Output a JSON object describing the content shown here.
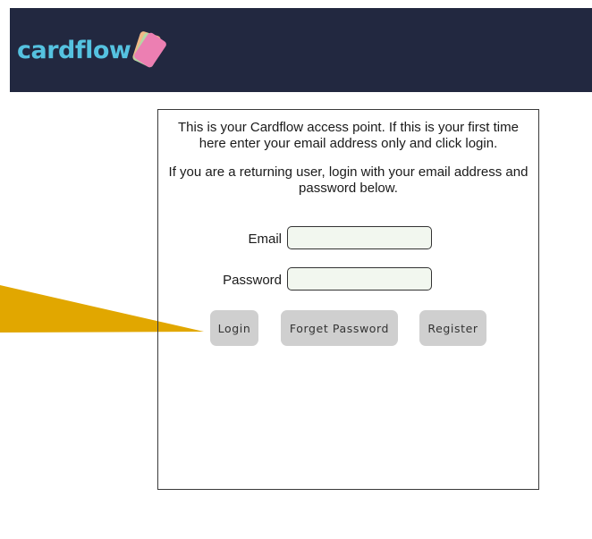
{
  "header": {
    "logo_text": "cardflow",
    "background_color": "#222840",
    "logo_color": "#55c2e0"
  },
  "panel": {
    "intro_text": "This is your Cardflow access point. If this is your first time here enter your email address only and click login.",
    "returning_text": "If you are a returning user, login with your email address and password below."
  },
  "form": {
    "email_label": "Email",
    "email_value": "",
    "password_label": "Password",
    "password_value": ""
  },
  "buttons": {
    "login": "Login",
    "forget_password": "Forget Password",
    "register": "Register"
  },
  "annotation": {
    "arrow_icon": "pointer-arrow-icon",
    "arrow_color": "#e1a700"
  }
}
